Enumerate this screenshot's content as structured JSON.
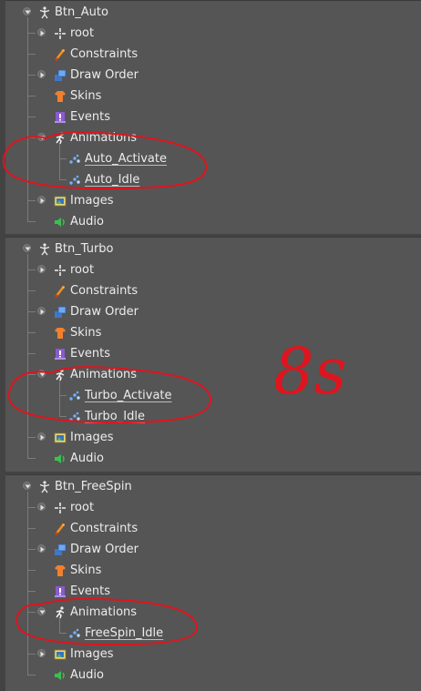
{
  "skeletons": [
    {
      "name": "Btn_Auto",
      "nodes": {
        "root": "root",
        "constraints": "Constraints",
        "draw_order": "Draw Order",
        "skins": "Skins",
        "events": "Events",
        "animations": "Animations",
        "images": "Images",
        "audio": "Audio"
      },
      "animations": [
        "Auto_Activate",
        "Auto_Idle"
      ]
    },
    {
      "name": "Btn_Turbo",
      "nodes": {
        "root": "root",
        "constraints": "Constraints",
        "draw_order": "Draw Order",
        "skins": "Skins",
        "events": "Events",
        "animations": "Animations",
        "images": "Images",
        "audio": "Audio"
      },
      "animations": [
        "Turbo_Activate",
        "Turbo_Idle"
      ]
    },
    {
      "name": "Btn_FreeSpin",
      "nodes": {
        "root": "root",
        "constraints": "Constraints",
        "draw_order": "Draw Order",
        "skins": "Skins",
        "events": "Events",
        "animations": "Animations",
        "images": "Images",
        "audio": "Audio"
      },
      "animations": [
        "FreeSpin_Idle"
      ]
    }
  ],
  "annotation": {
    "handwritten_note": "8s",
    "highlight_color": "#e0141e"
  }
}
